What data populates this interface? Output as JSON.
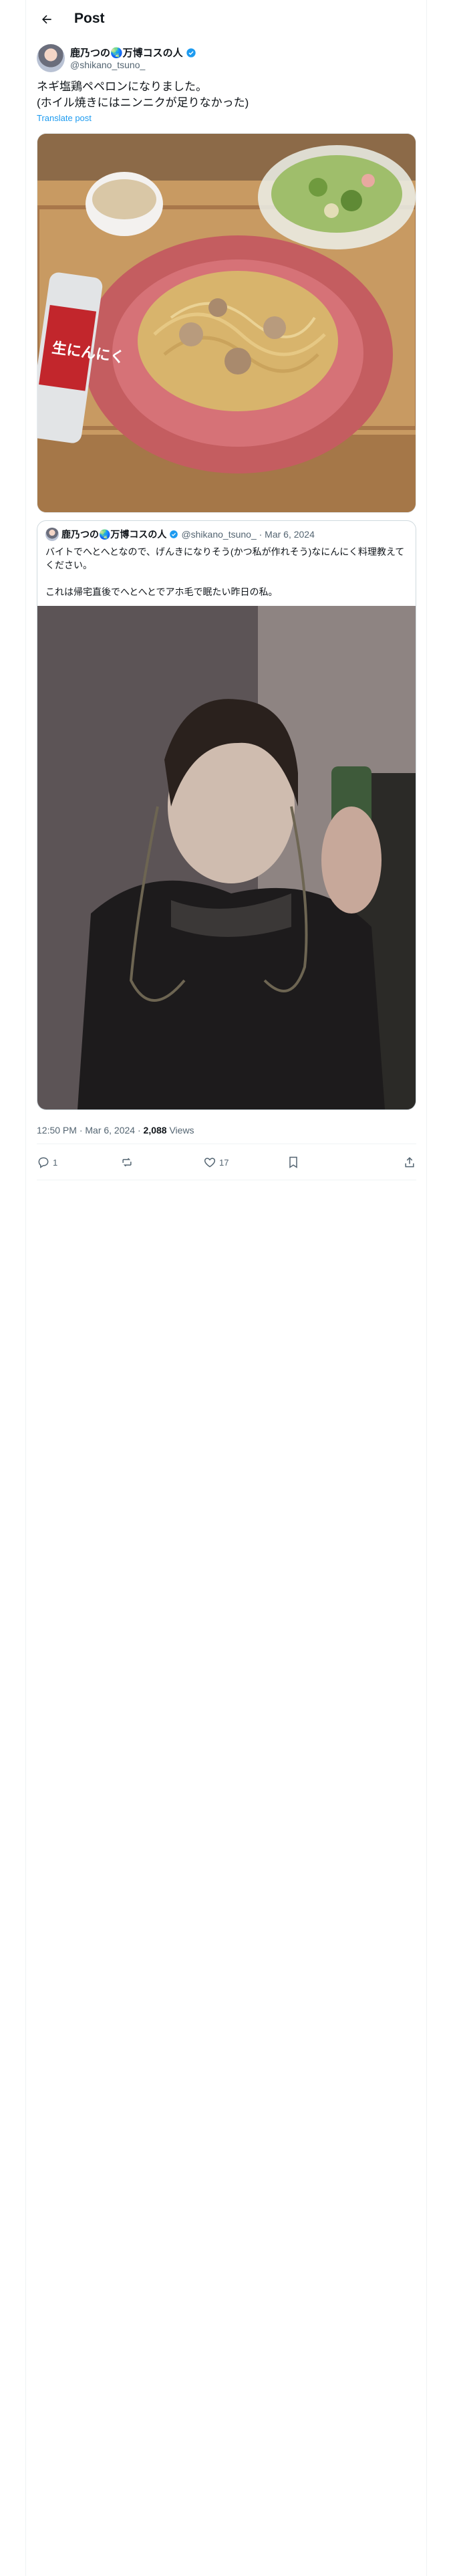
{
  "header": {
    "title": "Post"
  },
  "tweet": {
    "author_name": "鹿乃つの🌏万博コスの人",
    "author_handle": "@shikano_tsuno_",
    "text": "ネギ塩鶏ペペロンになりました。\n(ホイル焼きにはニンニクが足りなかった)",
    "translate_label": "Translate post",
    "photo_label": "生にんにく",
    "timestamp": "12:50 PM · Mar 6, 2024 · ",
    "views_count": "2,088",
    "views_label": " Views"
  },
  "quote": {
    "author_name": "鹿乃つの🌏万博コスの人",
    "meta": "@shikano_tsuno_ · Mar 6, 2024",
    "text": "バイトでへとへとなので、げんきになりそう(かつ私が作れそう)なにんにく料理教えてください。\n\nこれは帰宅直後でへとへとでアホ毛で眠たい昨日の私。"
  },
  "actions": {
    "replies": "1",
    "reposts": "",
    "likes": "17"
  },
  "colors": {
    "accent": "#1d9bf0",
    "muted": "#536471",
    "border": "#cfd9de"
  },
  "icons": [
    "back-arrow-icon",
    "verified-badge-icon",
    "reply-icon",
    "repost-icon",
    "like-icon",
    "bookmark-icon",
    "share-icon"
  ]
}
